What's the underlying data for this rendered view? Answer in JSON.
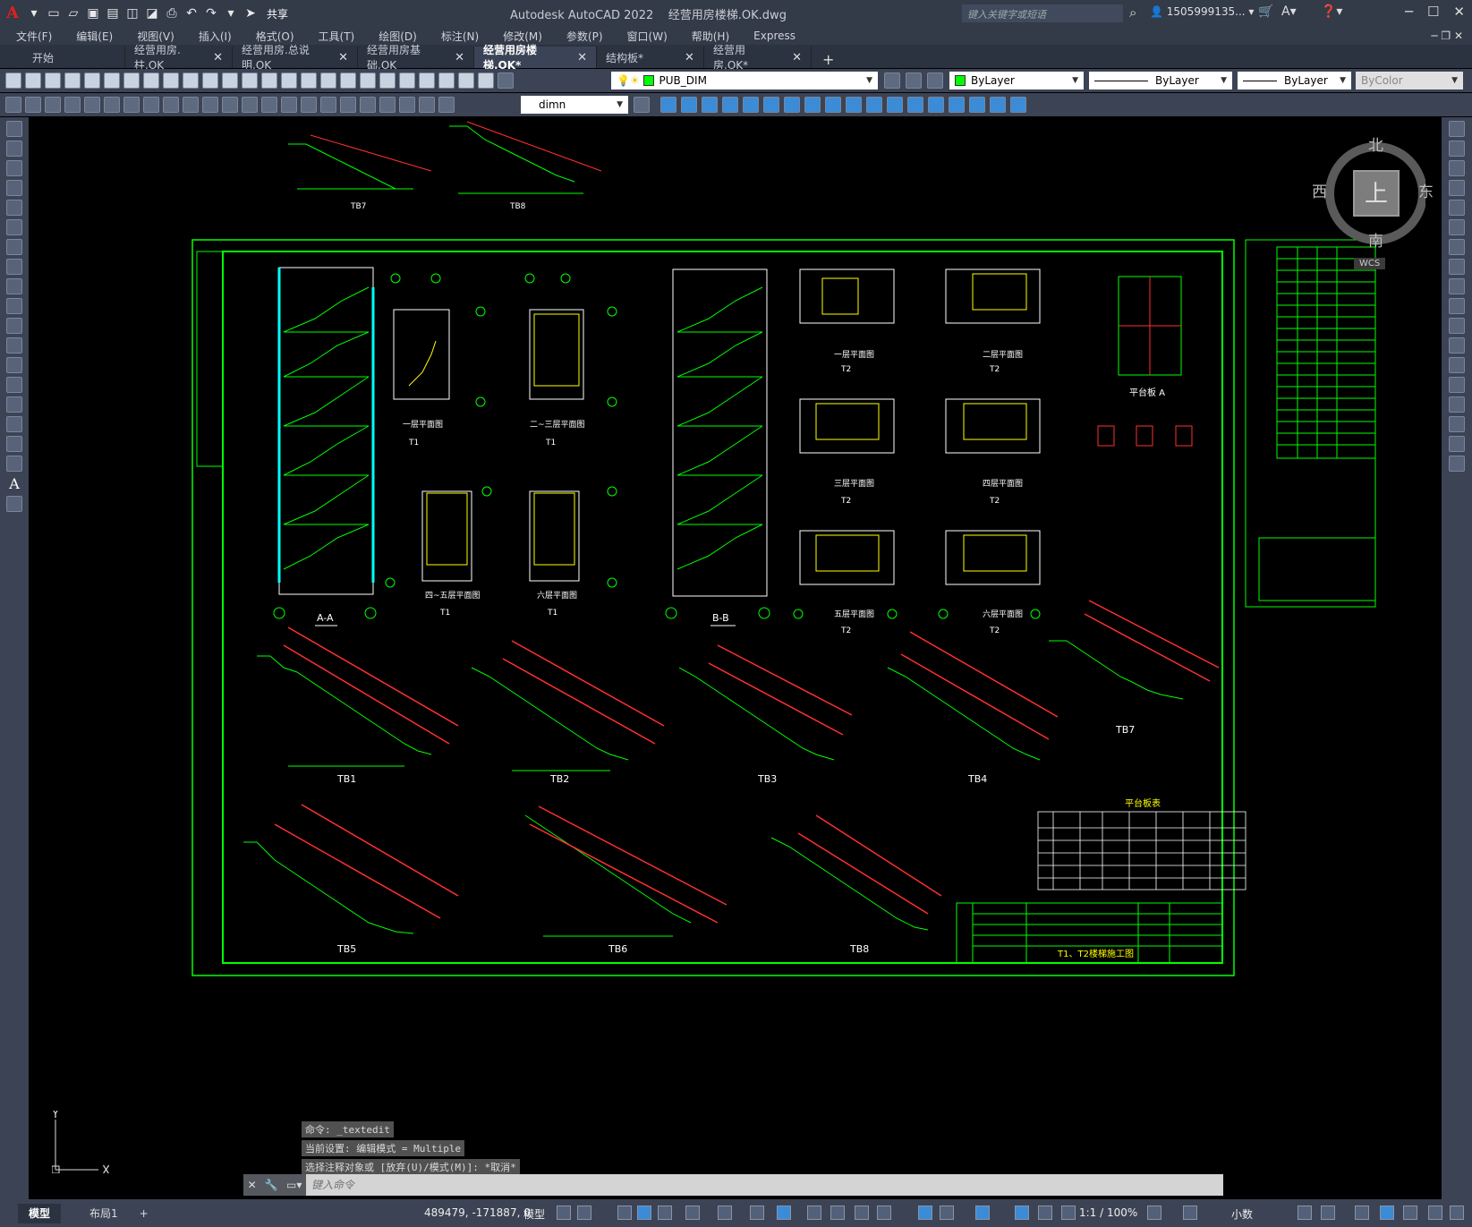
{
  "app": {
    "title": "Autodesk AutoCAD 2022",
    "filename": "经营用房楼梯.OK.dwg",
    "search_placeholder": "键入关键字或短语",
    "user": "1505999135...",
    "share": "共享"
  },
  "menu": [
    "文件(F)",
    "编辑(E)",
    "视图(V)",
    "插入(I)",
    "格式(O)",
    "工具(T)",
    "绘图(D)",
    "标注(N)",
    "修改(M)",
    "参数(P)",
    "窗口(W)",
    "帮助(H)",
    "Express"
  ],
  "tabs": [
    {
      "label": "开始",
      "active": false
    },
    {
      "label": "经营用房.柱.OK",
      "active": false
    },
    {
      "label": "经营用房.总说明.OK",
      "active": false
    },
    {
      "label": "经营用房基础.OK",
      "active": false
    },
    {
      "label": "经营用房楼梯.OK*",
      "active": true
    },
    {
      "label": "结构板*",
      "active": false
    },
    {
      "label": "经营用房.OK*",
      "active": false
    }
  ],
  "toolbar": {
    "layer": "PUB_DIM",
    "color": "ByLayer",
    "linetype": "ByLayer",
    "lineweight": "ByLayer",
    "plotstyle": "ByColor",
    "dimstyle": "dimn"
  },
  "viewcube": {
    "n": "北",
    "s": "南",
    "e": "东",
    "w": "西",
    "top": "上",
    "wcs": "WCS"
  },
  "drawing": {
    "plans": [
      "一层平面图",
      "二~三层平面图",
      "四~五层平面图",
      "六层平面图",
      "一层平面图",
      "二层平面图",
      "三层平面图",
      "四层平面图",
      "五层平面图",
      "六层平面图"
    ],
    "plan_tags": [
      "T1",
      "T1",
      "T1",
      "T1",
      "T2",
      "T2",
      "T2",
      "T2",
      "T2",
      "T2"
    ],
    "sections": [
      "A-A",
      "B-B"
    ],
    "flights": [
      "TB1",
      "TB2",
      "TB3",
      "TB4",
      "TB7",
      "TB5",
      "TB6",
      "TB8"
    ],
    "platform": "平台板 A",
    "table_title": "平台板表",
    "sheet_title": "T1、T2楼梯施工图"
  },
  "command": {
    "history": [
      "命令: _textedit",
      "当前设置: 编辑模式 = Multiple",
      "选择注释对象或 [放弃(U)/模式(M)]: *取消*"
    ],
    "placeholder": "键入命令"
  },
  "status": {
    "coords": "489479, -171887, 0",
    "model": "模型",
    "scale": "1:1 / 100%",
    "units": "小数",
    "layout_tabs": [
      "模型",
      "布局1"
    ]
  },
  "colors": {
    "green": "#00ff00",
    "yellow": "#ffff00",
    "red": "#ff0000",
    "white": "#ffffff",
    "cyan": "#00ffff"
  }
}
